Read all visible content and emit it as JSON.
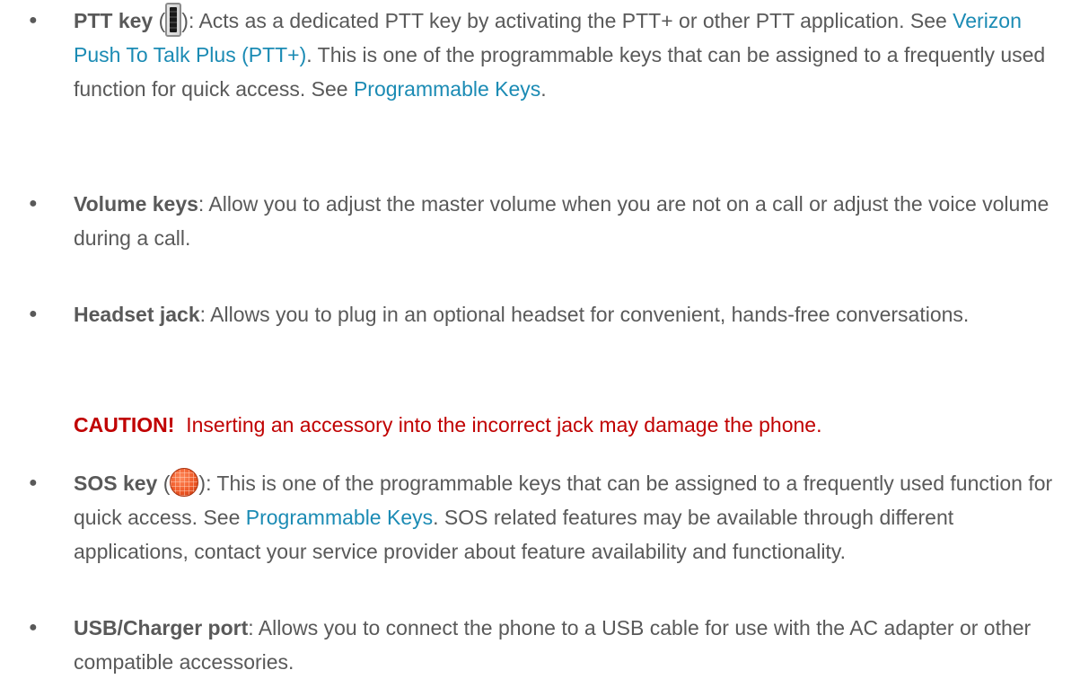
{
  "items": [
    {
      "term": "PTT key",
      "icon": "ptt-key-icon",
      "open_paren": " (",
      "close_text": "): Acts as a dedicated PTT key by activating the PTT+ or other PTT application. See ",
      "link1": "Verizon Push To Talk Plus (PTT+)",
      "mid_text": ". This is one of the programmable keys that can be assigned to a frequently used function for quick access. See ",
      "link2": "Programmable Keys",
      "end_text": "."
    },
    {
      "term": "Volume keys",
      "text": ": Allow you to adjust the master volume when you are not on a call or adjust the voice volume during a call."
    },
    {
      "term": "Headset jack",
      "text": ": Allows you to plug in an optional headset for convenient, hands-free conversations."
    },
    {
      "term": "SOS key",
      "icon": "sos-key-icon",
      "open_paren": " (",
      "close_text": "): This is one of the programmable keys that can be assigned to a frequently used function for quick access. See ",
      "link1": "Programmable Keys",
      "end_text": ". SOS related features may be available through different applications, contact your service provider about feature availability and functionality."
    },
    {
      "term": "USB/Charger port",
      "text": ": Allows you to connect the phone to a USB cable for use with the AC adapter or other compatible accessories."
    }
  ],
  "caution": {
    "label": "CAUTION!",
    "text": "  Inserting an accessory into the incorrect jack may damage the phone."
  },
  "bullet_char": "●",
  "colors": {
    "body_text": "#595959",
    "link": "#1b8bb4",
    "caution": "#c00000"
  }
}
